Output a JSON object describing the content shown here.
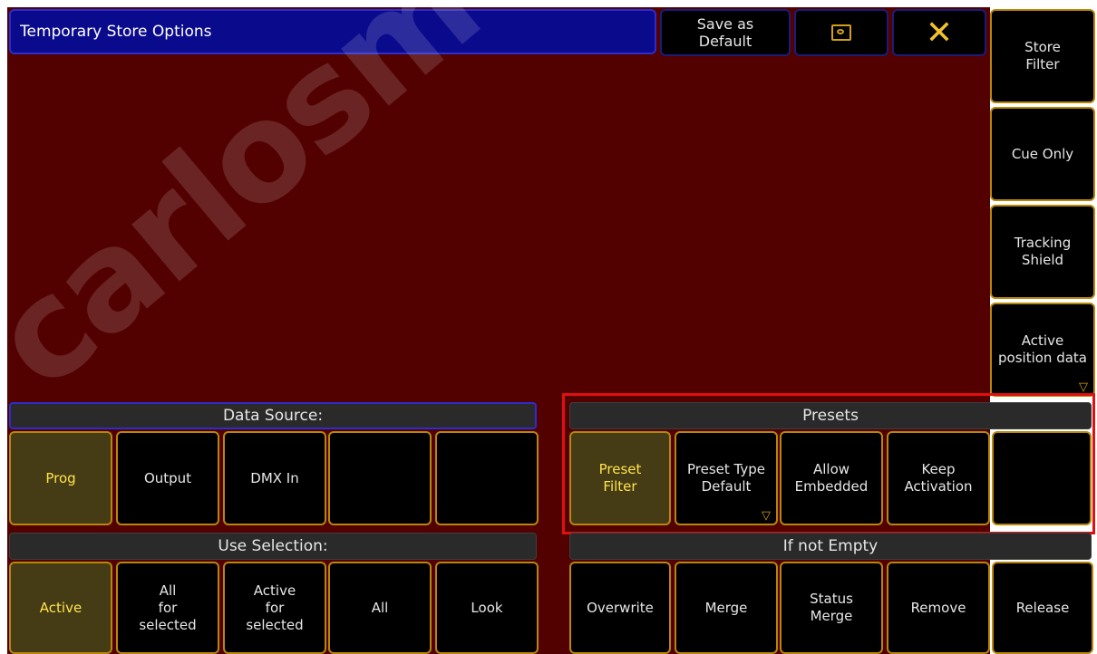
{
  "title": "Temporary Store Options",
  "top_buttons": {
    "save_default": "Save as\nDefault",
    "screen_icon": "monitor-icon",
    "close_icon": "close-x-icon"
  },
  "side_buttons": [
    "Store\nFilter",
    "Cue Only",
    "Tracking\nShield",
    "Active\nposition data"
  ],
  "data_source": {
    "header": "Data Source:",
    "buttons": [
      "Prog",
      "Output",
      "DMX In",
      "",
      ""
    ]
  },
  "presets": {
    "header": "Presets",
    "buttons": [
      "Preset\nFilter",
      "Preset Type\nDefault",
      "Allow\nEmbedded",
      "Keep\nActivation",
      ""
    ]
  },
  "use_selection": {
    "header": "Use Selection:",
    "buttons": [
      "Active",
      "All\nfor\nselected",
      "Active\nfor\nselected",
      "All",
      "Look"
    ]
  },
  "if_not_empty": {
    "header": "If not Empty",
    "buttons": [
      "Overwrite",
      "Merge",
      "Status\nMerge",
      "Remove",
      "Release"
    ]
  },
  "watermark": "carlosmendoza",
  "colors": {
    "background": "#520000",
    "title_bar": "#0a0a8c",
    "active_text": "#ffe44a",
    "button_border": "#b8860b",
    "highlight_frame": "#e01010"
  }
}
